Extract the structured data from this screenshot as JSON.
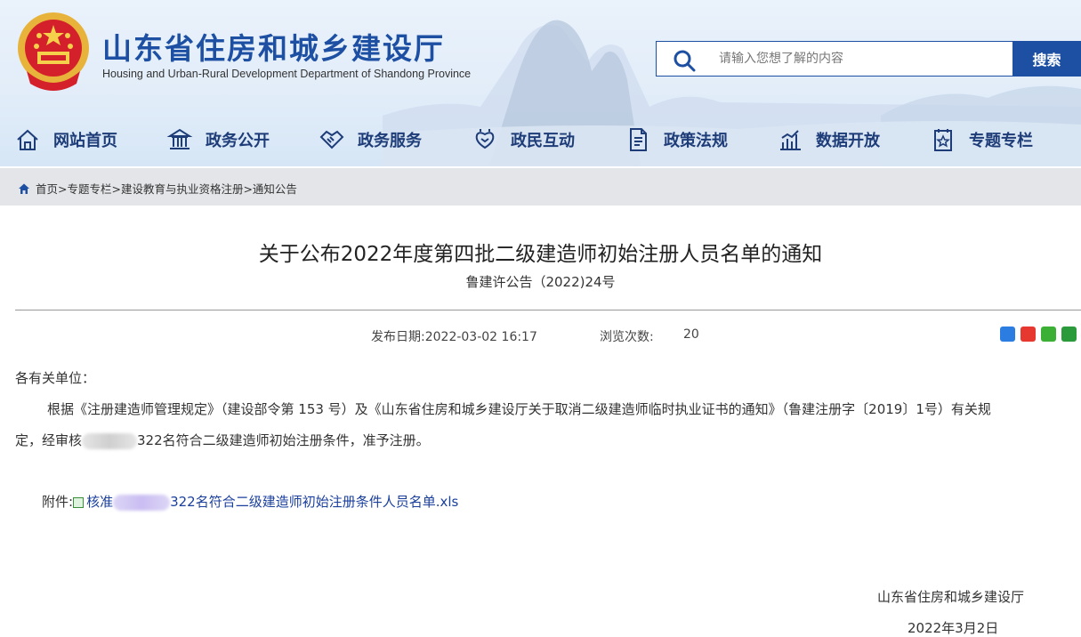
{
  "header": {
    "title": "山东省住房和城乡建设厅",
    "subtitle": "Housing and Urban-Rural Development Department of Shandong Province"
  },
  "search": {
    "placeholder": "请输入您想了解的内容",
    "button_label": "搜索"
  },
  "nav": {
    "items": [
      {
        "label": "网站首页",
        "icon": "home-icon"
      },
      {
        "label": "政务公开",
        "icon": "government-building-icon"
      },
      {
        "label": "政务服务",
        "icon": "handshake-icon"
      },
      {
        "label": "政民互动",
        "icon": "interaction-icon"
      },
      {
        "label": "政策法规",
        "icon": "document-icon"
      },
      {
        "label": "数据开放",
        "icon": "bar-chart-icon"
      },
      {
        "label": "专题专栏",
        "icon": "topic-icon"
      }
    ]
  },
  "breadcrumb": {
    "text": "首页>专题专栏>建设教育与执业资格注册>通知公告"
  },
  "article": {
    "title": "关于公布2022年度第四批二级建造师初始注册人员名单的通知",
    "doc_number": "鲁建许公告（2022)24号",
    "publish_label": "发布日期:",
    "publish_date": "2022-03-02 16:17",
    "views_label": "浏览次数:",
    "views": "20",
    "salutation": "各有关单位：",
    "para_line1": "根据《注册建造师管理规定》（建设部令第 153 号）及《山东省住房和城乡建设厅关于取消二级建造师临时执业证书的通知》（鲁建注册字〔2019〕1号）有关规",
    "para_line2_prefix": "定，经审核",
    "para_line2_suffix": "322名符合二级建造师初始注册条件，准予注册。",
    "attachment_label": "附件:",
    "attachment_prefix": "核准",
    "attachment_suffix": "322名符合二级建造师初始注册条件人员名单.xls",
    "signature_org": "山东省住房和城乡建设厅",
    "signature_date": "2022年3月2日"
  },
  "colors": {
    "brand_blue": "#1d4fa3",
    "nav_text": "#1d3c78",
    "link": "#1a3f9c",
    "breadcrumb_bg": "#e3e5e8"
  }
}
